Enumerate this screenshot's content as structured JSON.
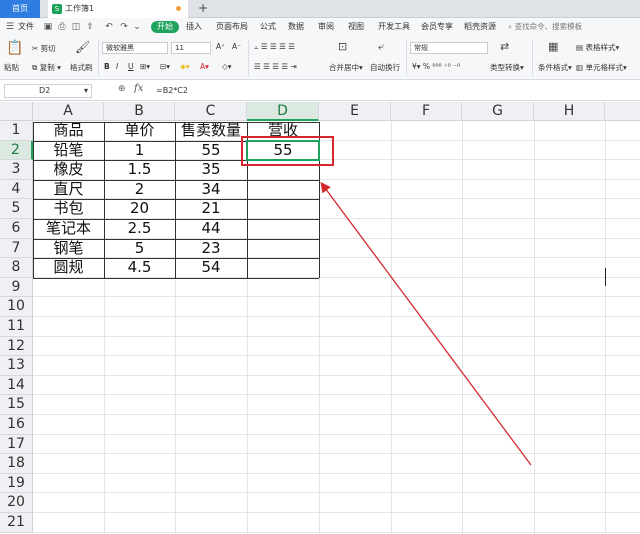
{
  "tabs": {
    "home_label": "首页",
    "doc_icon": "S",
    "doc_title": "工作簿1",
    "add": "+"
  },
  "menu": {
    "file": "文件",
    "items": [
      {
        "label": "开始",
        "active": true
      },
      {
        "label": "插入"
      },
      {
        "label": "页面布局"
      },
      {
        "label": "公式"
      },
      {
        "label": "数据"
      },
      {
        "label": "审阅"
      },
      {
        "label": "视图"
      },
      {
        "label": "开发工具"
      },
      {
        "label": "会员专享"
      },
      {
        "label": "稻壳资源"
      }
    ],
    "search_placeholder": "查找命令、搜索模板"
  },
  "ribbon": {
    "cut": "剪切",
    "paste": "粘贴",
    "copy": "复制",
    "format_painter": "格式刷",
    "font_name": "微软雅黑",
    "font_size": "11",
    "merge_center": "合并居中",
    "wrap_text": "自动换行",
    "number_format": "常规",
    "type_convert": "类型转换",
    "conditional_format": "条件格式",
    "table_style": "表格样式",
    "cell_style": "单元格样式"
  },
  "formula_bar": {
    "name_box": "D2",
    "fx": "fx",
    "formula": "=B2*C2"
  },
  "columns": [
    "A",
    "B",
    "C",
    "D",
    "E",
    "F",
    "G",
    "H"
  ],
  "rows": [
    "1",
    "2",
    "3",
    "4",
    "5",
    "6",
    "7",
    "8",
    "9",
    "10",
    "11",
    "12",
    "13",
    "14",
    "15",
    "16",
    "17",
    "18",
    "19",
    "20",
    "21"
  ],
  "table": {
    "header": [
      "商品",
      "单价",
      "售卖数量",
      "营收"
    ],
    "rows": [
      [
        "铅笔",
        "1",
        "55",
        "55"
      ],
      [
        "橡皮",
        "1.5",
        "35",
        ""
      ],
      [
        "直尺",
        "2",
        "34",
        ""
      ],
      [
        "书包",
        "20",
        "21",
        ""
      ],
      [
        "笔记本",
        "2.5",
        "44",
        ""
      ],
      [
        "钢笔",
        "5",
        "23",
        ""
      ],
      [
        "圆规",
        "4.5",
        "54",
        ""
      ]
    ]
  },
  "colors": {
    "accent_green": "#1fa35f",
    "annotation_red": "#d5282e",
    "home_tab_blue": "#2f7de1"
  }
}
